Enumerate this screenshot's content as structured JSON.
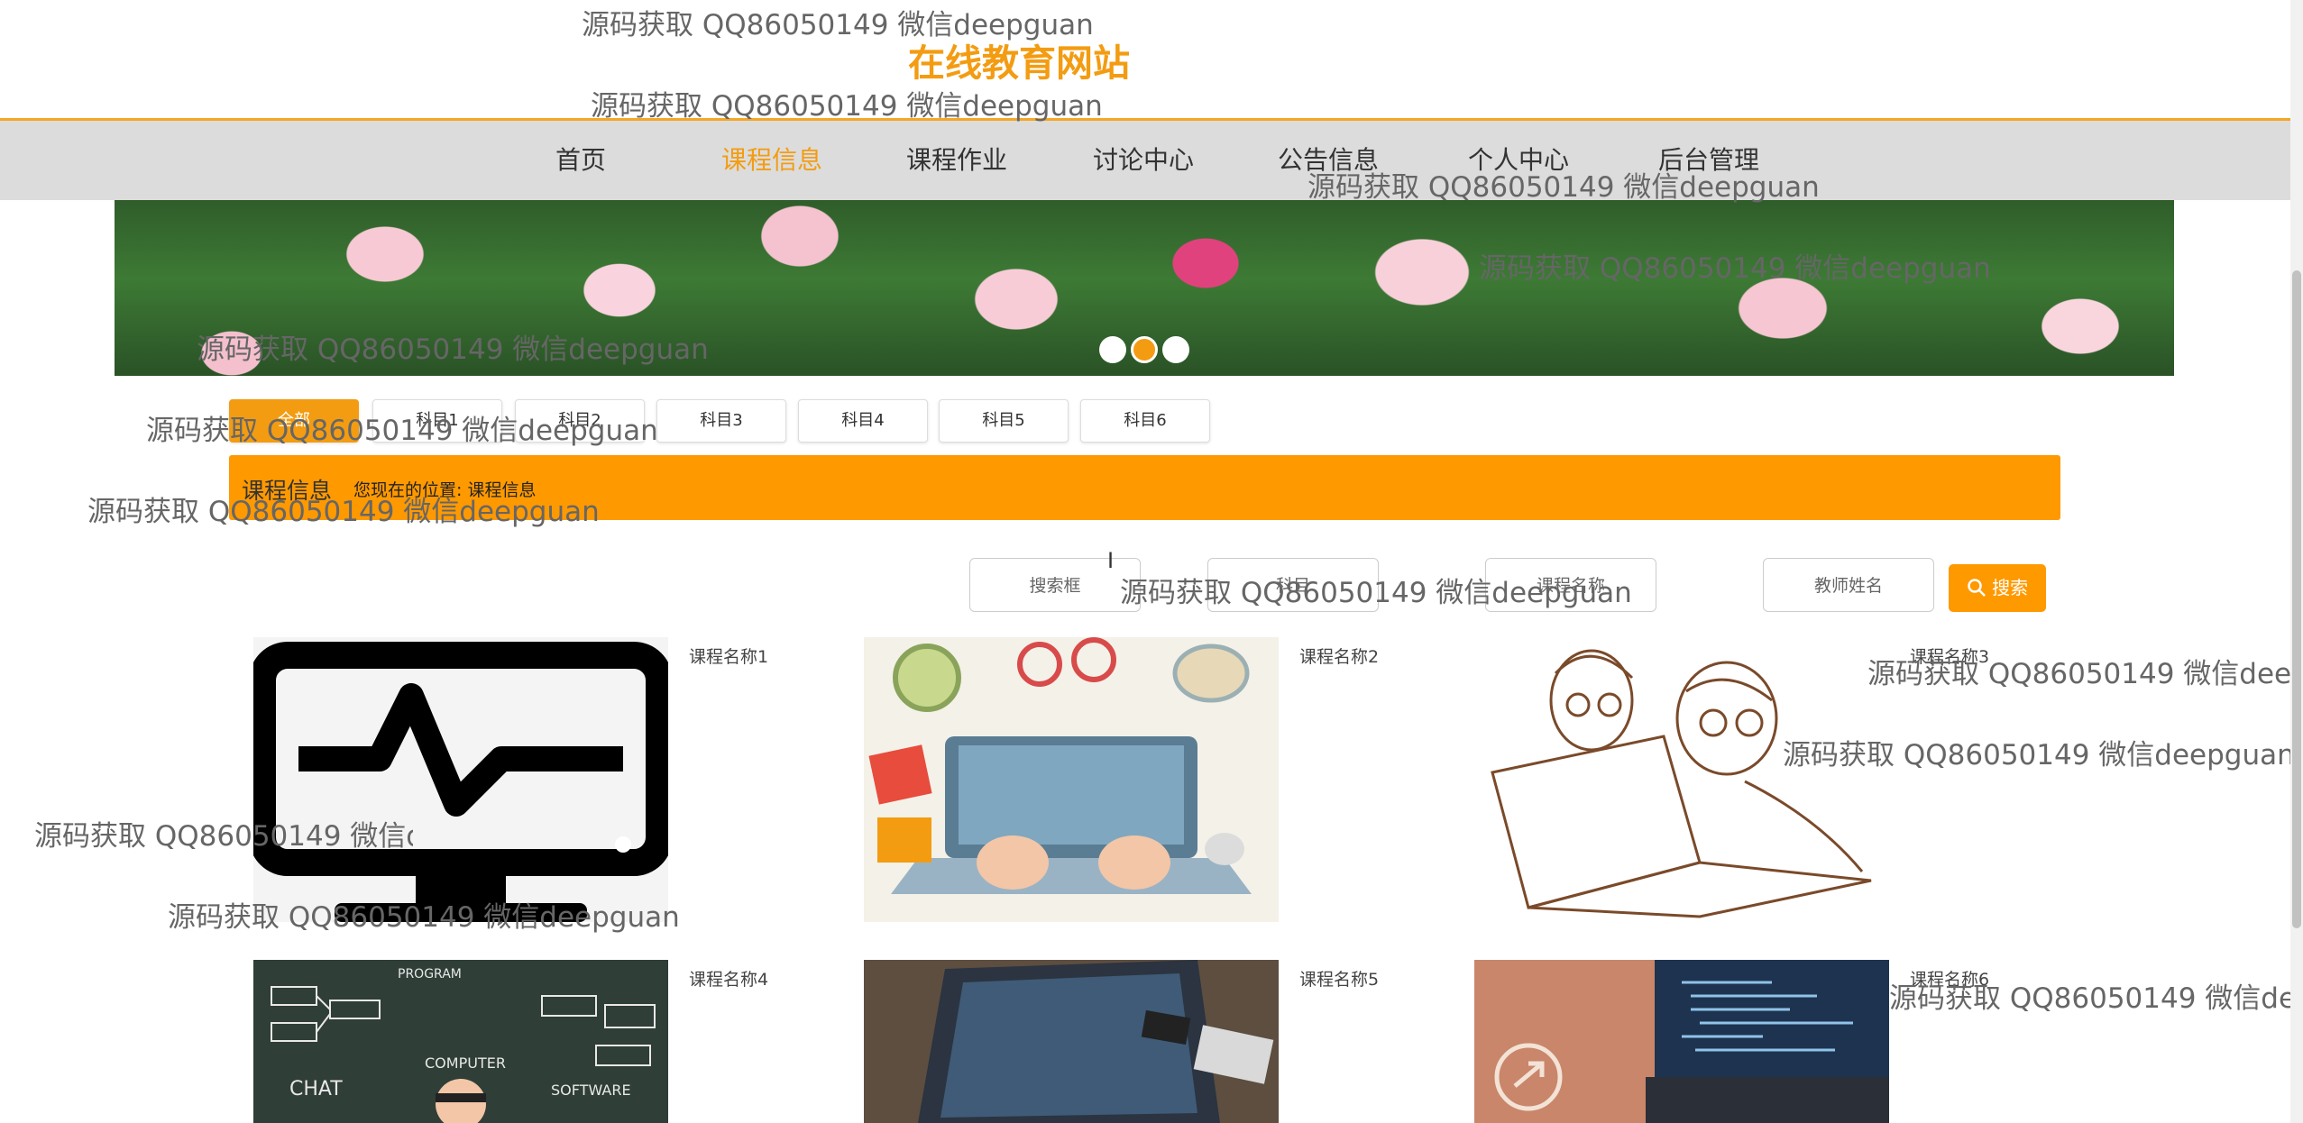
{
  "header": {
    "title": "在线教育网站"
  },
  "nav": {
    "items": [
      {
        "label": "首页"
      },
      {
        "label": "课程信息"
      },
      {
        "label": "课程作业"
      },
      {
        "label": "讨论中心"
      },
      {
        "label": "公告信息"
      },
      {
        "label": "个人中心"
      },
      {
        "label": "后台管理"
      }
    ],
    "active": "课程信息"
  },
  "banner": {
    "slide_count": 3,
    "active_slide": 2
  },
  "subjects": [
    {
      "label": "全部"
    },
    {
      "label": "科目1"
    },
    {
      "label": "科目2"
    },
    {
      "label": "科目3"
    },
    {
      "label": "科目4"
    },
    {
      "label": "科目5"
    },
    {
      "label": "科目6"
    }
  ],
  "section": {
    "title": "课程信息",
    "location_label": "您现在的位置:",
    "location_value": "课程信息"
  },
  "search": {
    "fields": [
      {
        "placeholder": "搜索框"
      },
      {
        "placeholder": "科目"
      },
      {
        "placeholder": "课程名称"
      },
      {
        "placeholder": "教师姓名"
      }
    ],
    "button_label": "搜索",
    "button_icon": "search-icon"
  },
  "courses": [
    {
      "name": "课程名称1",
      "image": "monitor-icon"
    },
    {
      "name": "课程名称2",
      "image": "laptop-illustration"
    },
    {
      "name": "课程名称3",
      "image": "sketch-people-laptop"
    },
    {
      "name": "课程名称4",
      "image": "programming-chalkboard"
    },
    {
      "name": "课程名称5",
      "image": "laptop-photo"
    },
    {
      "name": "课程名称6",
      "image": "code-laptop-photo"
    }
  ],
  "watermark": {
    "text": "源码获取 QQ86050149 微信deepguan"
  },
  "colors": {
    "accent": "#f39c12",
    "section_bar": "#ff9900",
    "nav_bg": "#dcdcdc"
  }
}
